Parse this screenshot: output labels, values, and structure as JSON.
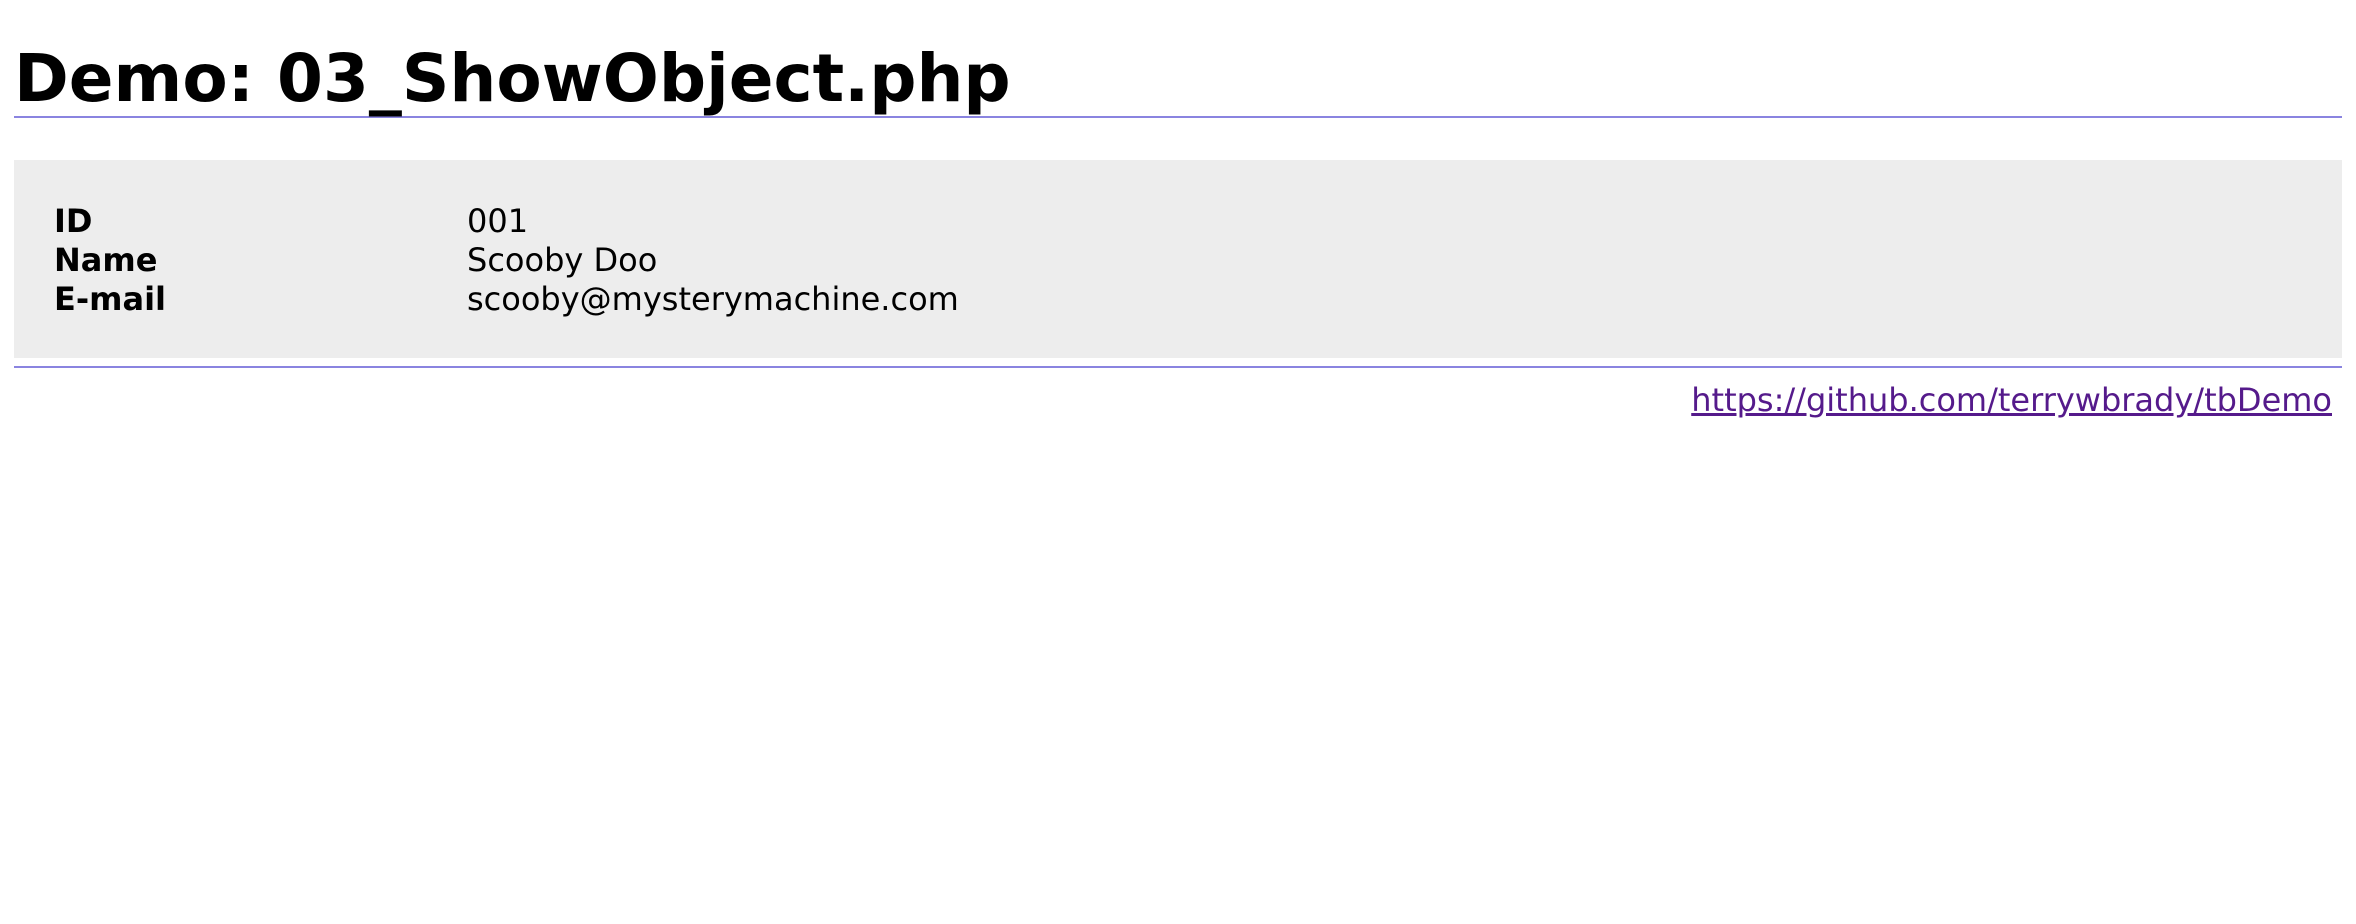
{
  "header": {
    "title": "Demo: 03_ShowObject.php"
  },
  "record": {
    "rows": [
      {
        "label": "ID",
        "value": "001"
      },
      {
        "label": "Name",
        "value": "Scooby Doo"
      },
      {
        "label": "E-mail",
        "value": "scooby@mysterymachine.com"
      }
    ]
  },
  "footer": {
    "link_text": "https://github.com/terrywbrady/tbDemo",
    "link_href": "https://github.com/terrywbrady/tbDemo"
  }
}
